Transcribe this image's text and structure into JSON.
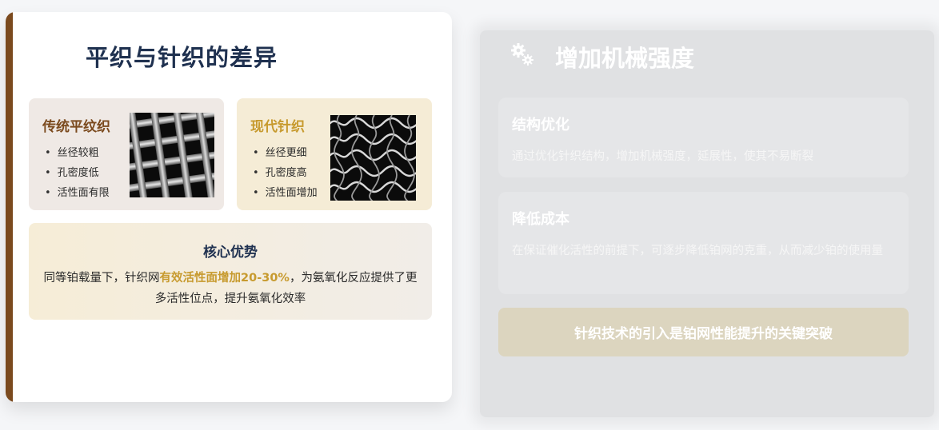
{
  "left": {
    "title": "平织与针织的差异",
    "plain": {
      "title": "传统平纹织",
      "items": [
        "丝径较粗",
        "孔密度低",
        "活性面有限"
      ]
    },
    "knit": {
      "title": "现代针织",
      "items": [
        "丝径更细",
        "孔密度高",
        "活性面增加"
      ]
    },
    "core": {
      "title": "核心优势",
      "text_pre": "同等铂载量下，针织网",
      "text_highlight": "有效活性面增加20-30%",
      "text_post": "，为氨氧化反应提供了更多活性位点，提升氨氧化效率"
    }
  },
  "right": {
    "icon": "gears-icon",
    "title": "增加机械强度",
    "items": [
      {
        "title": "结构优化",
        "text": "通过优化针织结构，增加机械强度，延展性，使其不易断裂"
      },
      {
        "title": "降低成本",
        "text": "在保证催化活性的前提下，可逐步降低铂网的克重，从而减少铂的使用量"
      }
    ],
    "banner": "针织技术的引入是铂网性能提升的关键突破"
  },
  "colors": {
    "accent_brown": "#7b4a1e",
    "accent_gold": "#c79a2e",
    "title_navy": "#1f3150"
  }
}
